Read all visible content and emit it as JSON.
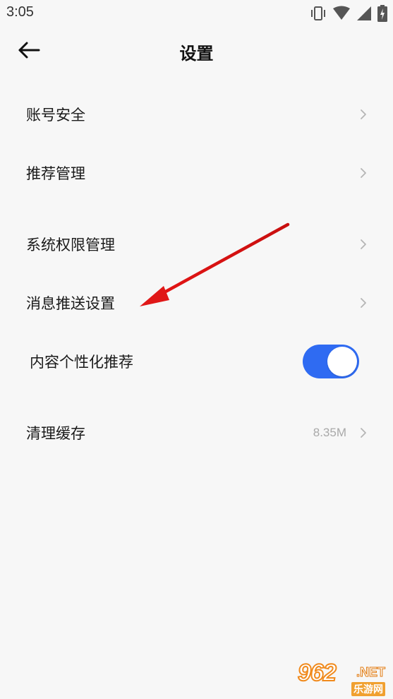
{
  "status_bar": {
    "time": "3:05",
    "icons": [
      "vibrate-icon",
      "wifi-icon",
      "signal-icon",
      "battery-charging-icon"
    ]
  },
  "header": {
    "title": "设置",
    "back_icon": "arrow-left-icon"
  },
  "settings": {
    "account_security": "账号安全",
    "recommend_manage": "推荐管理",
    "system_permissions": "系统权限管理",
    "push_settings": "消息推送设置",
    "personalized_recommend": "内容个性化推荐",
    "personalized_enabled": true,
    "clear_cache": "清理缓存",
    "cache_size": "8.35M"
  },
  "colors": {
    "toggle_on": "#2f6bf2",
    "arrow_red": "#e01818",
    "background": "#f7f7f7"
  },
  "watermark": {
    "main": "962",
    "net": ".NET",
    "sub": "乐游网"
  }
}
